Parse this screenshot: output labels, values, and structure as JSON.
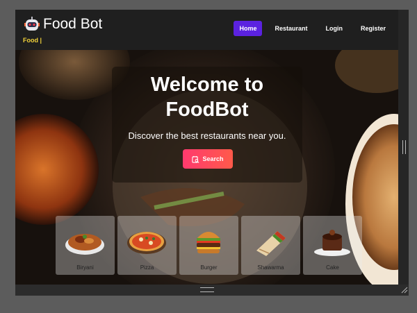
{
  "app": {
    "title": "Food Bot",
    "tagline": "Food |"
  },
  "nav": {
    "items": [
      {
        "label": "Home",
        "active": true
      },
      {
        "label": "Restaurant",
        "active": false
      },
      {
        "label": "Login",
        "active": false
      },
      {
        "label": "Register",
        "active": false
      }
    ]
  },
  "hero": {
    "title_line1": "Welcome to",
    "title_line2": "FoodBot",
    "subtitle": "Discover the best restaurants near you.",
    "search_label": "Search"
  },
  "categories": [
    {
      "label": "Biryani",
      "icon": "biryani-bowl"
    },
    {
      "label": "Pizza",
      "icon": "pizza"
    },
    {
      "label": "Burger",
      "icon": "burger"
    },
    {
      "label": "Shawarma",
      "icon": "shawarma-wrap"
    },
    {
      "label": "Cake",
      "icon": "chocolate-cake"
    }
  ],
  "colors": {
    "nav_active": "#5b22e0",
    "tagline": "#f2d23a",
    "search_gradient_start": "#ff3a6e",
    "search_gradient_end": "#ff5a4a"
  }
}
